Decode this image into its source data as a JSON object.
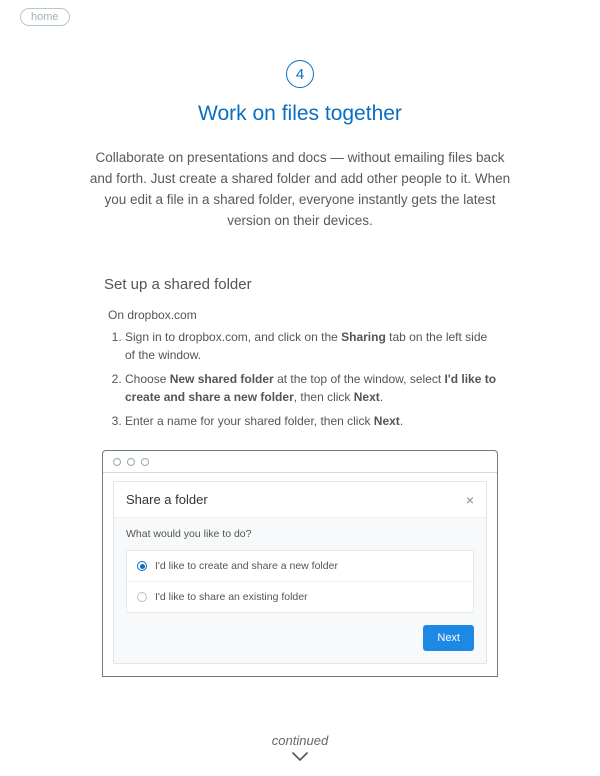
{
  "nav": {
    "home_label": "home"
  },
  "step": {
    "number": "4",
    "title": "Work on files together"
  },
  "intro": "Collaborate on presentations and docs — without emailing files back and forth. Just create a shared folder and add other people to it. When you edit a file in a shared folder, everyone instantly gets the latest version on their devices.",
  "section": {
    "heading": "Set up a shared folder",
    "on_site": "On dropbox.com",
    "steps": [
      {
        "pre": "Sign in to dropbox.com, and click on the ",
        "b1": "Sharing",
        "mid": " tab on the left side of the window.",
        "b2": "",
        "post": ""
      },
      {
        "pre": "Choose ",
        "b1": "New shared folder",
        "mid": " at the top of the window, select ",
        "b2": "I'd like to create and share a new folder",
        "post": ", then click ",
        "b3": "Next",
        "tail": "."
      },
      {
        "pre": "Enter a name for your shared folder, then click ",
        "b1": "Next",
        "mid": ".",
        "b2": "",
        "post": ""
      }
    ]
  },
  "dialog": {
    "title": "Share a folder",
    "prompt": "What would you like to do?",
    "options": [
      {
        "label": "I'd like to create and share a new folder",
        "selected": true
      },
      {
        "label": "I'd like to share an existing folder",
        "selected": false
      }
    ],
    "next_label": "Next"
  },
  "footer": {
    "continued": "continued"
  }
}
